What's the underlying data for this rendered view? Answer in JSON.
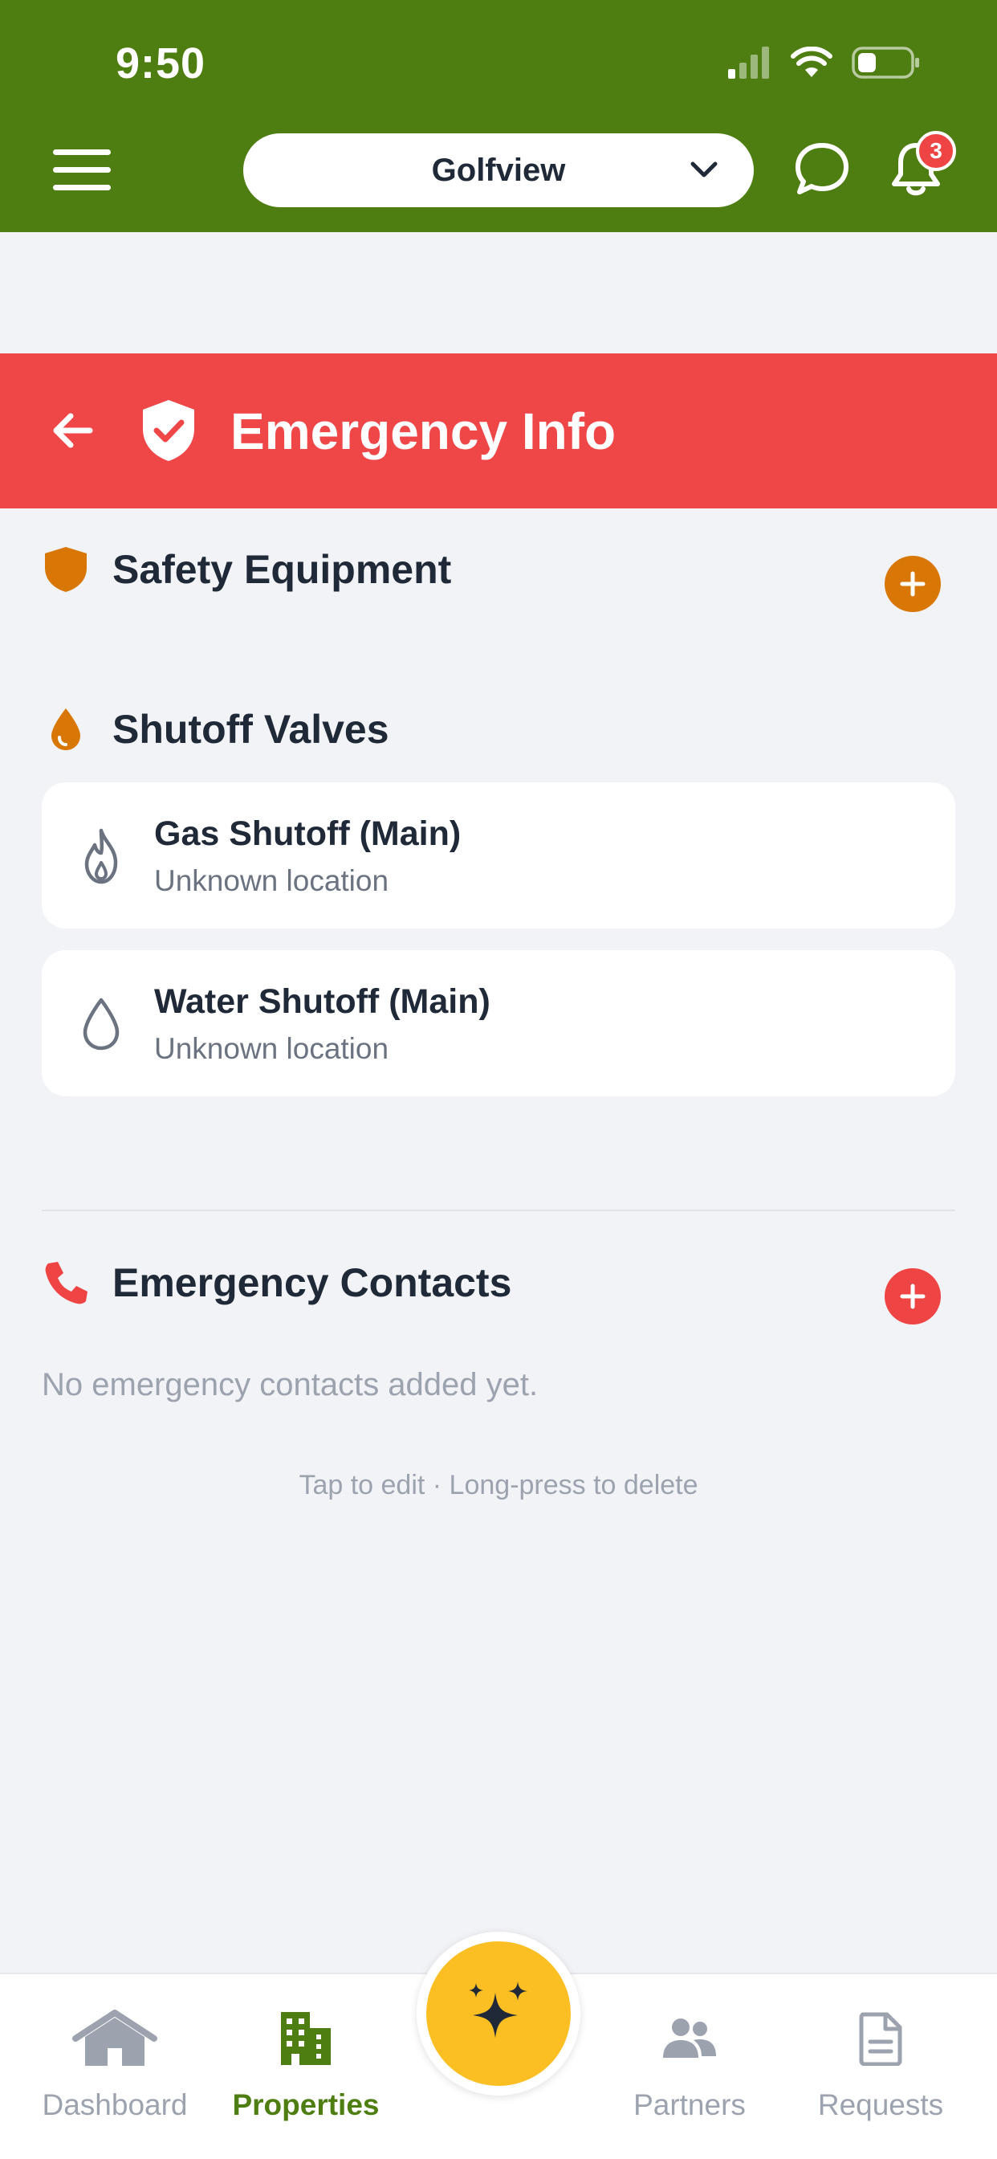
{
  "status_bar": {
    "time": "9:50"
  },
  "header": {
    "property_selector": {
      "value": "Golfview"
    },
    "notification_count": "3"
  },
  "banner": {
    "title": "Emergency Info"
  },
  "safety_equipment": {
    "title": "Safety Equipment"
  },
  "shutoff_valves": {
    "title": "Shutoff Valves",
    "items": [
      {
        "title": "Gas Shutoff (Main)",
        "location": "Unknown location"
      },
      {
        "title": "Water Shutoff (Main)",
        "location": "Unknown location"
      }
    ]
  },
  "emergency_contacts": {
    "title": "Emergency Contacts",
    "empty_text": "No emergency contacts added yet."
  },
  "hint": "Tap to edit · Long-press to delete",
  "bottom_nav": {
    "items": [
      {
        "label": "Dashboard"
      },
      {
        "label": "Properties"
      },
      {
        "label": "Partners"
      },
      {
        "label": "Requests"
      }
    ],
    "active": "Properties"
  },
  "colors": {
    "header": "#4e7e11",
    "banner": "#ef4648",
    "safety_accent": "#d97706",
    "contacts_accent": "#ef4444",
    "fab": "#fbbf24"
  }
}
